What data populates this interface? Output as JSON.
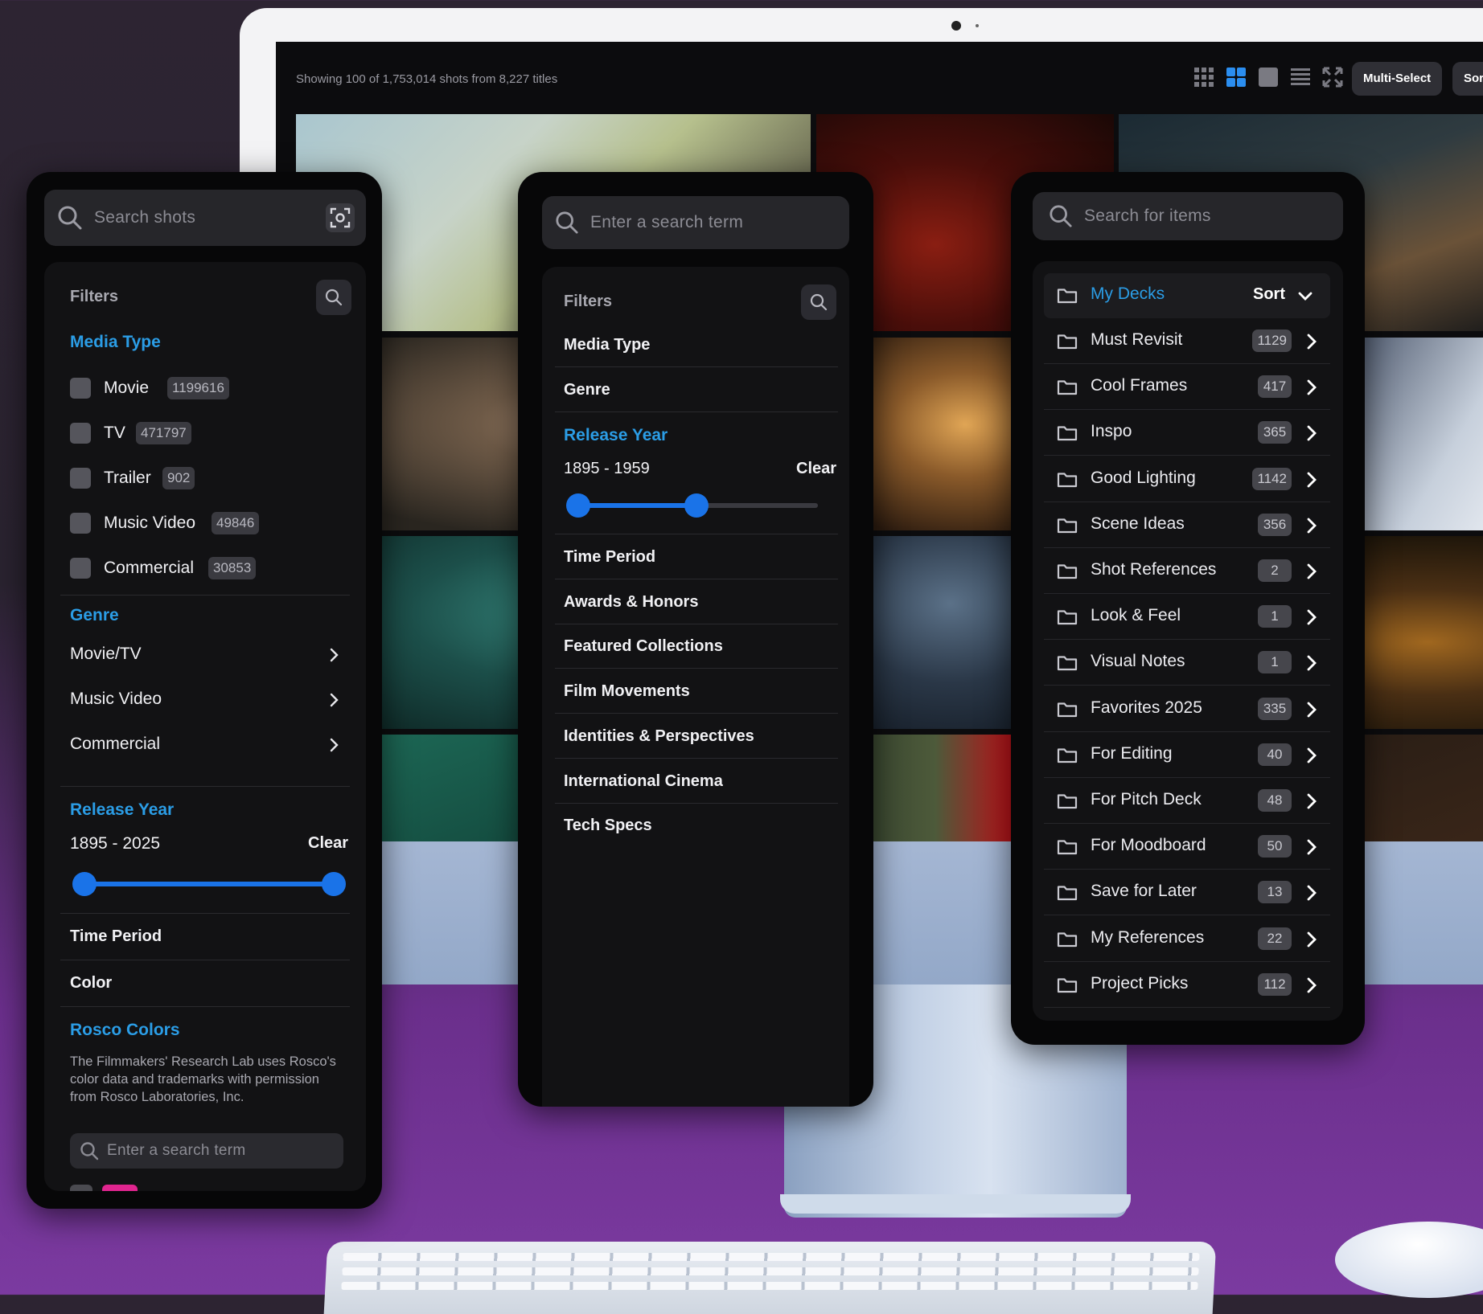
{
  "screen": {
    "status": "Showing 100 of 1,753,014 shots from 8,227 titles",
    "multi_select_label": "Multi-Select",
    "sort_label": "Sor"
  },
  "left_panel": {
    "search_placeholder": "Search shots",
    "filters_title": "Filters",
    "media_type_title": "Media Type",
    "media_types": [
      {
        "label": "Movie",
        "count": "1199616"
      },
      {
        "label": "TV",
        "count": "471797"
      },
      {
        "label": "Trailer",
        "count": "902"
      },
      {
        "label": "Music Video",
        "count": "49846"
      },
      {
        "label": "Commercial",
        "count": "30853"
      }
    ],
    "genre_title": "Genre",
    "genres": [
      "Movie/TV",
      "Music Video",
      "Commercial"
    ],
    "release_year_title": "Release Year",
    "release_year_range": "1895 - 2025",
    "clear_label": "Clear",
    "slider": {
      "min": 1895,
      "max": 2025,
      "low": 1895,
      "high": 2025
    },
    "time_period_label": "Time Period",
    "color_label": "Color",
    "rosco_title": "Rosco Colors",
    "rosco_note": "The Filmmakers' Research Lab uses Rosco's color data and trademarks with permission from Rosco Laboratories, Inc.",
    "rosco_search_placeholder": "Enter a search term"
  },
  "middle_panel": {
    "search_placeholder": "Enter a search term",
    "filters_title": "Filters",
    "items_top": [
      "Media Type",
      "Genre"
    ],
    "release_year_title": "Release Year",
    "release_year_range": "1895 - 1959",
    "clear_label": "Clear",
    "slider": {
      "min": 1895,
      "max": 2025,
      "low": 1895,
      "high": 1959
    },
    "items_bottom": [
      "Time Period",
      "Awards & Honors",
      "Featured Collections",
      "Film Movements",
      "Identities & Perspectives",
      "International Cinema",
      "Tech Specs"
    ]
  },
  "right_panel": {
    "search_placeholder": "Search for items",
    "my_decks_label": "My Decks",
    "sort_label": "Sort",
    "decks": [
      {
        "name": "Must Revisit",
        "count": "1129"
      },
      {
        "name": "Cool Frames",
        "count": "417"
      },
      {
        "name": "Inspo",
        "count": "365"
      },
      {
        "name": "Good Lighting",
        "count": "1142"
      },
      {
        "name": "Scene Ideas",
        "count": "356"
      },
      {
        "name": "Shot References",
        "count": "2"
      },
      {
        "name": "Look & Feel",
        "count": "1"
      },
      {
        "name": "Visual Notes",
        "count": "1"
      },
      {
        "name": "Favorites 2025",
        "count": "335"
      },
      {
        "name": "For Editing",
        "count": "40"
      },
      {
        "name": "For Pitch Deck",
        "count": "48"
      },
      {
        "name": "For Moodboard",
        "count": "50"
      },
      {
        "name": "Save for Later",
        "count": "13"
      },
      {
        "name": "My References",
        "count": "22"
      },
      {
        "name": "Project Picks",
        "count": "112"
      }
    ]
  },
  "colors": {
    "accent_blue": "#2b9de6",
    "slider_blue": "#1a73e8",
    "panel_bg": "#070708",
    "background_purple": "#7b3aa0"
  }
}
